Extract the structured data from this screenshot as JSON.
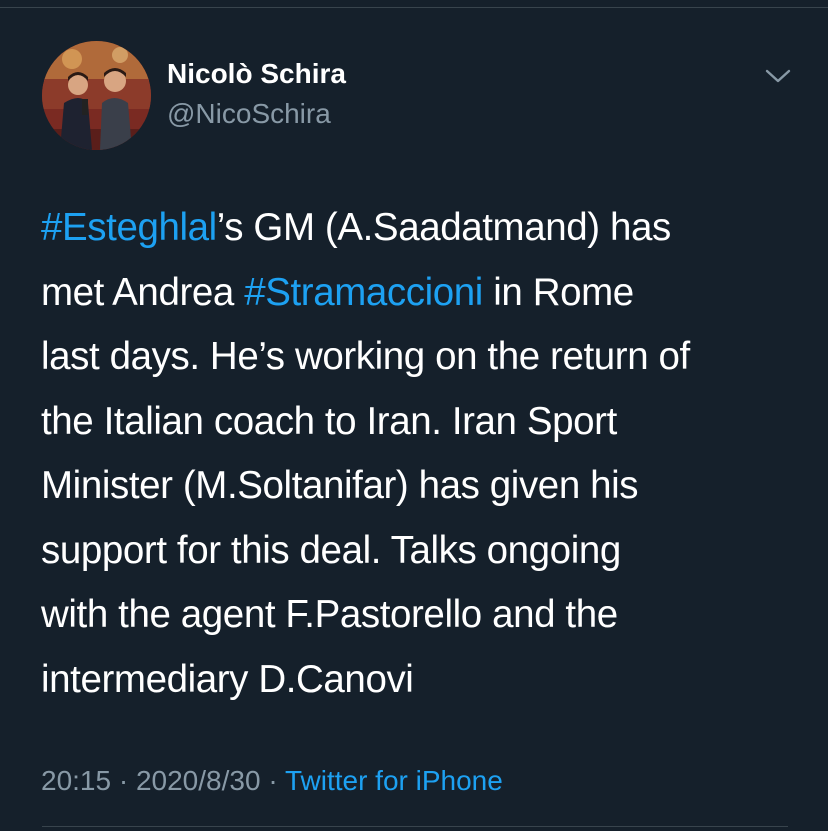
{
  "author": {
    "display_name": "Nicolò Schira",
    "handle": "@NicoSchira"
  },
  "tweet": {
    "part1_hashtag": "#Esteghlal",
    "part2": "’s GM (A.Saadatmand) has\nmet Andrea ",
    "part3_hashtag": "#Stramaccioni",
    "part4": " in Rome\nlast days. He’s working on the return of\nthe Italian coach to Iran. Iran Sport\nMinister (M.Soltanifar) has given his\nsupport for this deal. Talks ongoing\nwith the agent F.Pastorello and the\nintermediary D.Canovi"
  },
  "meta": {
    "time": "20:15",
    "separator1": " · ",
    "date": "2020/8/30",
    "separator2": " · ",
    "source": "Twitter for iPhone"
  },
  "icons": {
    "menu": "chevron-down-icon",
    "avatar": "profile-photo"
  },
  "colors": {
    "background": "#15202b",
    "text": "#ffffff",
    "secondary": "#8899a6",
    "accent": "#1da1f2"
  }
}
